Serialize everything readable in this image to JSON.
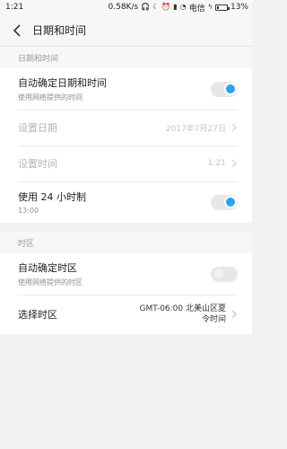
{
  "status": {
    "time": "1:21",
    "speed": "0.58K/s",
    "carrier": "电信",
    "battery_pct": "13%",
    "battery_level": 0.13
  },
  "header": {
    "title": "日期和时间",
    "back_icon": "chevron-left-icon"
  },
  "sections": {
    "datetime": {
      "label": "日期和时间",
      "auto_datetime": {
        "title": "自动确定日期和时间",
        "subtitle": "使用网络提供的时间",
        "enabled": true
      },
      "set_date": {
        "title": "设置日期",
        "value": "2017年7月27日"
      },
      "set_time": {
        "title": "设置时间",
        "value": "1:21"
      },
      "use_24h": {
        "title": "使用 24 小时制",
        "subtitle": "13:00",
        "enabled": true
      }
    },
    "timezone": {
      "label": "时区",
      "auto_timezone": {
        "title": "自动确定时区",
        "subtitle": "使用网络提供的时区",
        "enabled": false
      },
      "select_timezone": {
        "title": "选择时区",
        "value_line1": "GMT-06:00 北美山区夏",
        "value_line2": "令时间"
      }
    }
  },
  "colors": {
    "accent": "#2aa3ef",
    "background": "#f2f2f2"
  }
}
